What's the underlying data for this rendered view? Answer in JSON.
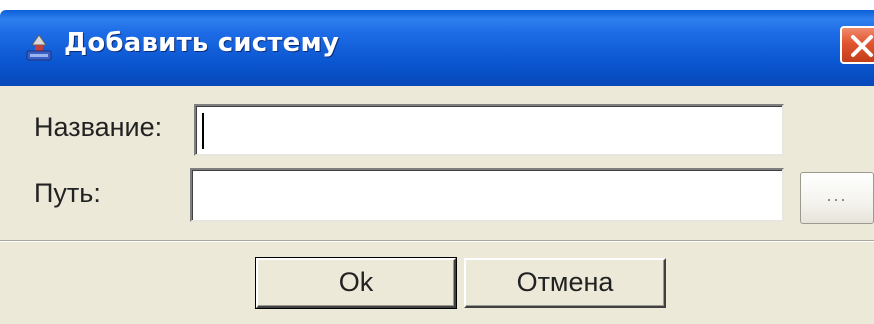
{
  "window": {
    "title": "Добавить систему",
    "icon": "computer-user-icon",
    "close_icon": "close-icon",
    "close_color": "#e0552f",
    "titlebar_color": "#0a56d0"
  },
  "form": {
    "name_label": "Название:",
    "name_value": "",
    "path_label": "Путь:",
    "path_value": "",
    "browse_label": "..."
  },
  "buttons": {
    "ok_label": "Ok",
    "cancel_label": "Отмена"
  }
}
